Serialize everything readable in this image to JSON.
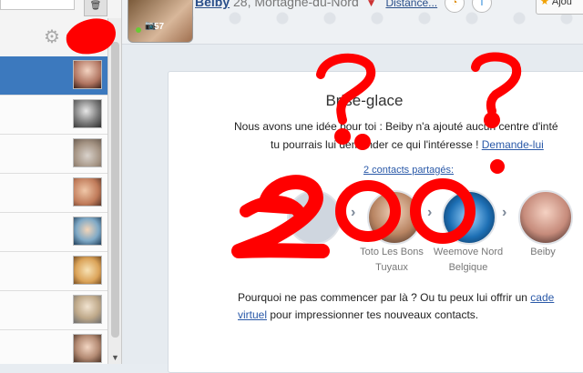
{
  "sidebar": {
    "trash_icon": "trash-icon",
    "gear_icon": "gear-icon",
    "conversations": [
      {
        "active": true,
        "thumb_color": "#d7a38c"
      },
      {
        "active": false,
        "thumb_color": "#8f8f8f"
      },
      {
        "active": false,
        "thumb_color": "#b9aca2"
      },
      {
        "active": false,
        "thumb_color": "#c98a6a"
      },
      {
        "active": false,
        "thumb_color": "#3f6f8c"
      },
      {
        "active": false,
        "thumb_color": "#e2b46a"
      },
      {
        "active": false,
        "thumb_color": "#c7bfae"
      },
      {
        "active": false,
        "thumb_color": "#a88f7e"
      }
    ]
  },
  "profile": {
    "name": "Beiby",
    "age_city": "28, Mortagne-du-Nord",
    "distance_link": "Distance...",
    "photo_count": "57",
    "add_button_label": "Ajou"
  },
  "icebreaker": {
    "title": "Brise-glace",
    "line1": "Nous avons une idée pour toi : Beiby n'a ajouté aucun centre d'inté",
    "line2_prefix": "tu pourrais lui demander ce qui l'intéresse ! ",
    "line2_link": "Demande-lui",
    "shared_link": "2 contacts partagés:",
    "chain": [
      {
        "label_1": "",
        "label_2": ""
      },
      {
        "label_1": "Toto Les Bons",
        "label_2": "Tuyaux"
      },
      {
        "label_1": "Weemove Nord",
        "label_2": "Belgique"
      },
      {
        "label_1": "Beiby",
        "label_2": ""
      }
    ],
    "bottom_line1_prefix": "Pourquoi ne pas commencer par là ? Ou tu peux lui offrir un ",
    "bottom_line1_link": "cade",
    "bottom_line2_link": "virtuel",
    "bottom_line2_suffix": " pour impressionner tes nouveaux contacts."
  },
  "colors": {
    "accent_blue": "#3c79be",
    "link_blue": "#2a59a8",
    "marker_red": "#ff0000"
  }
}
